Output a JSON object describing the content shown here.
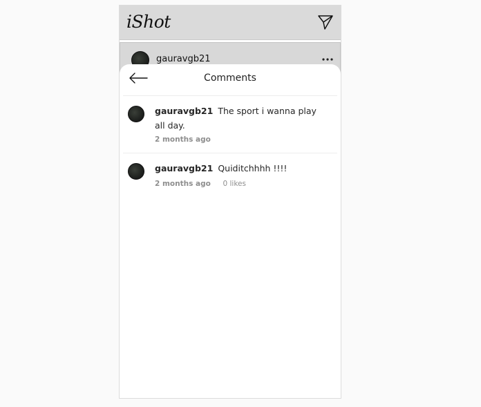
{
  "app": {
    "logo": "iShot",
    "send_icon": "send-icon"
  },
  "post": {
    "username": "gauravgb21",
    "more_icon": "more-horizontal-icon"
  },
  "comments_sheet": {
    "title": "Comments",
    "back_icon": "arrow-left-icon",
    "comments": [
      {
        "username": "gauravgb21",
        "text": "The sport i wanna play all day.",
        "time": "2 months ago"
      },
      {
        "username": "gauravgb21",
        "text": "Quiditchhhh !!!!",
        "time": "2 months ago",
        "likes": "0 likes"
      }
    ]
  }
}
